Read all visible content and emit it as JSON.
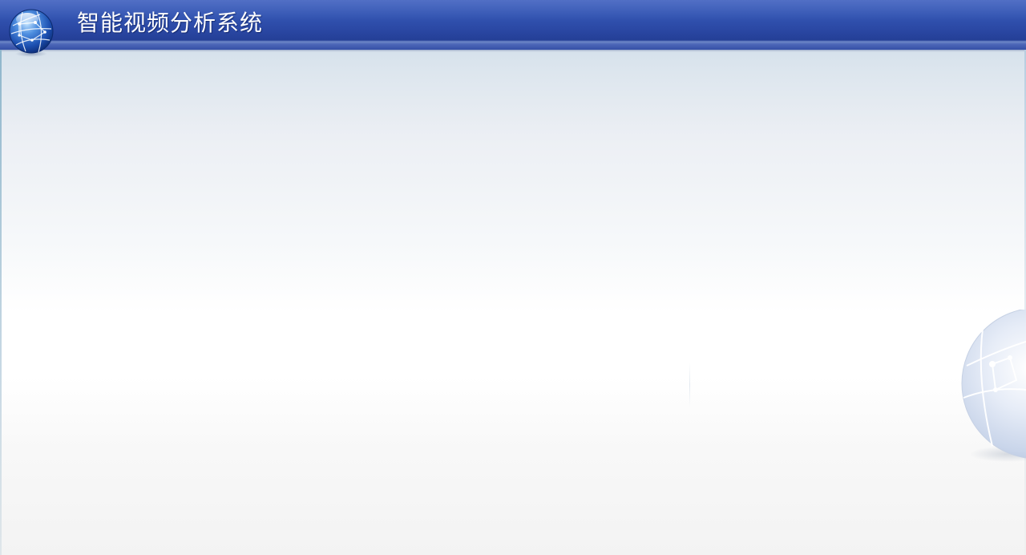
{
  "header": {
    "title": "智能视频分析系统",
    "logo_icon": "globe-icon",
    "bar_color": "#3150ad",
    "title_color": "#ffffff"
  },
  "main": {
    "background_decoration_icon": "globe-watermark-icon"
  }
}
